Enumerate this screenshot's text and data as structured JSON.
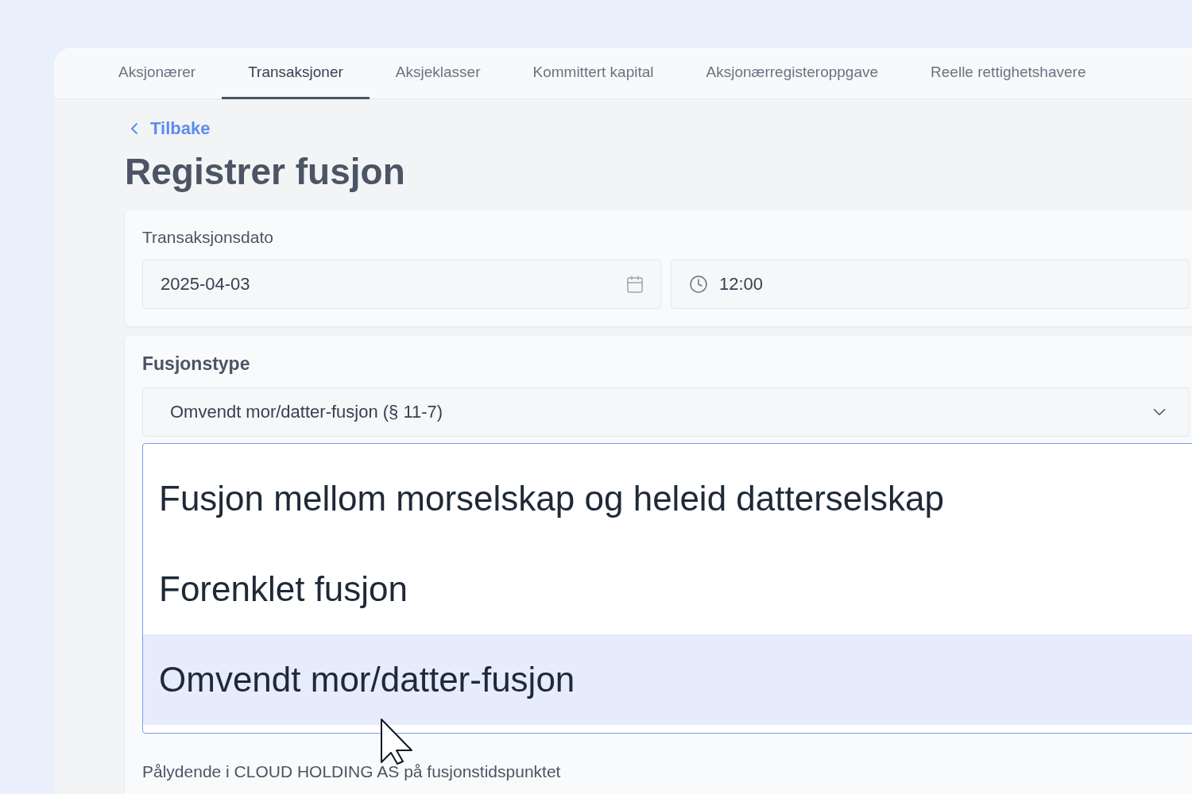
{
  "tabs": [
    {
      "label": "Aksjonærer",
      "selected": false
    },
    {
      "label": "Transaksjoner",
      "selected": true
    },
    {
      "label": "Aksjeklasser",
      "selected": false
    },
    {
      "label": "Kommittert kapital",
      "selected": false
    },
    {
      "label": "Aksjonærregisteroppgave",
      "selected": false
    },
    {
      "label": "Reelle rettighetshavere",
      "selected": false
    }
  ],
  "back_link": "Tilbake",
  "title": "Registrer fusjon",
  "transaction_date": {
    "label": "Transaksjonsdato",
    "date": "2025-04-03",
    "time": "12:00"
  },
  "merger_type": {
    "label": "Fusjonstype",
    "value": "Omvendt mor/datter-fusjon (§ 11-7)",
    "expanded": true,
    "options": [
      {
        "label": "Fusjon mellom morselskap og heleid datterselskap",
        "selected": false
      },
      {
        "label": "Forenklet fusjon",
        "selected": false
      },
      {
        "label": "Omvendt mor/datter-fusjon",
        "selected": true
      }
    ]
  },
  "next_field_label": "Pålydende i CLOUD HOLDING AS på fusjonstidspunktet"
}
